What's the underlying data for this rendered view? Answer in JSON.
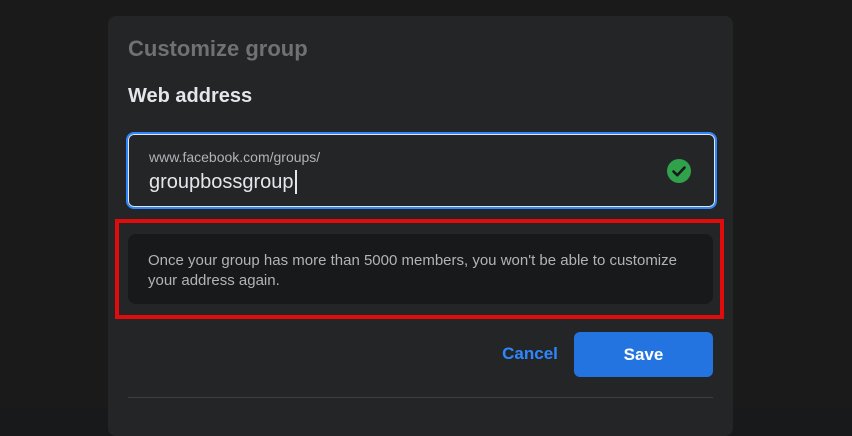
{
  "dialog": {
    "title": "Customize group",
    "section_title": "Web address",
    "address_field": {
      "prefix": "www.facebook.com/groups/",
      "value": "groupbossgroup",
      "status": "valid"
    },
    "notice": "Once your group has more than 5000 members, you won't be able to customize your address again.",
    "cancel_label": "Cancel",
    "save_label": "Save"
  },
  "colors": {
    "accent": "#2d88ff",
    "save_button": "#2374e1",
    "valid_check": "#31a24c",
    "highlight": "#e00b0b"
  }
}
